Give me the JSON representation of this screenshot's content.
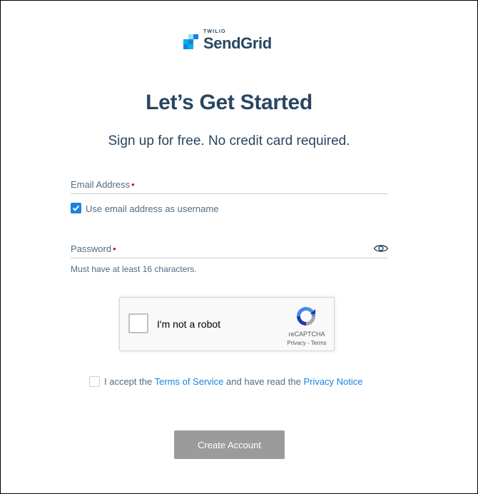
{
  "brand": {
    "small": "TWILIO",
    "name": "SendGrid",
    "colors": [
      "#1a82e2",
      "#00b3e3",
      "#99e1f4",
      "#294661"
    ]
  },
  "heading": {
    "title": "Let’s Get Started",
    "subtitle": "Sign up for free. No credit card required."
  },
  "email": {
    "label": "Email Address",
    "required_mark": "•",
    "value": "",
    "use_as_username_label": "Use email address as username",
    "use_as_username_checked": true
  },
  "password": {
    "label": "Password",
    "required_mark": "•",
    "value": "",
    "hint": "Must have at least 16 characters.",
    "toggle_icon": "eye-icon"
  },
  "recaptcha": {
    "label": "I'm not a robot",
    "brand": "reCAPTCHA",
    "privacy": "Privacy",
    "separator": " - ",
    "terms": "Terms"
  },
  "terms": {
    "prefix": "I accept the ",
    "terms_link": "Terms of Service",
    "middle": " and have read the ",
    "privacy_link": "Privacy Notice",
    "checked": false
  },
  "submit": {
    "label": "Create Account",
    "color": "#9b9b9b"
  }
}
